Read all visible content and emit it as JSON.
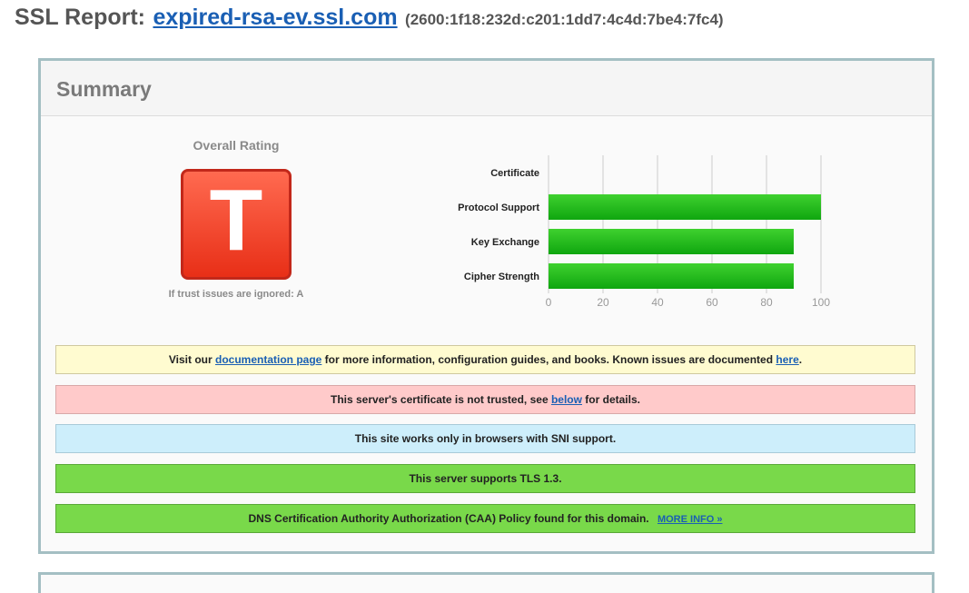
{
  "header": {
    "label": "SSL Report:",
    "host": "expired-rsa-ev.ssl.com",
    "ip": "(2600:1f18:232d:c201:1dd7:4c4d:7be4:7fc4)"
  },
  "summary": {
    "title": "Summary",
    "rating_label": "Overall Rating",
    "grade": "T",
    "grade_note": "If trust issues are ignored: A",
    "colors": {
      "grade": "#e83a1f",
      "bar": "#22b81a",
      "link": "#1a5fb4"
    }
  },
  "chart_data": {
    "type": "bar",
    "orientation": "horizontal",
    "categories": [
      "Certificate",
      "Protocol Support",
      "Key Exchange",
      "Cipher Strength"
    ],
    "values": [
      0,
      100,
      90,
      90
    ],
    "xlim": [
      0,
      100
    ],
    "ticks": [
      0,
      20,
      40,
      60,
      80,
      100
    ],
    "grid": true
  },
  "notices": {
    "doc": {
      "pre": "Visit our ",
      "link": "documentation page",
      "mid": " for more information, configuration guides, and books. Known issues are documented ",
      "link2": "here",
      "post": "."
    },
    "trust": {
      "pre": "This server's certificate is not trusted, see ",
      "link": "below",
      "post": " for details."
    },
    "sni": {
      "text": "This site works only in browsers with SNI support."
    },
    "tls": {
      "text": "This server supports TLS 1.3."
    },
    "caa": {
      "text": "DNS Certification Authority Authorization (CAA) Policy found for this domain.",
      "link": "MORE INFO »"
    }
  }
}
